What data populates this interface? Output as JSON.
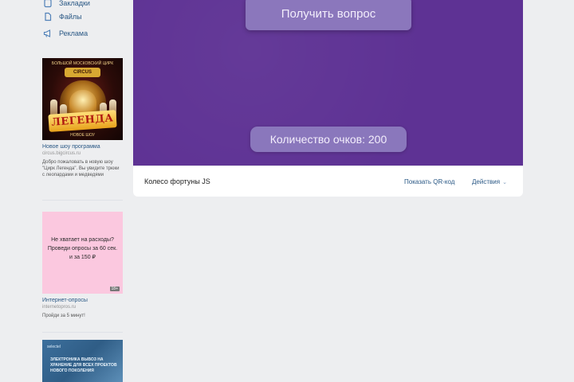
{
  "sidebar": {
    "items": [
      {
        "label": "Закладки",
        "icon": "bookmark-icon"
      },
      {
        "label": "Файлы",
        "icon": "file-icon"
      },
      {
        "label": "Реклама",
        "icon": "megaphone-icon"
      }
    ]
  },
  "ads": [
    {
      "banner_top": "БОЛЬШОЙ МОСКОВСКИЙ ЦИРК",
      "banner_logo": "CIRCUS",
      "banner_headline": "ЛЕГЕНДА",
      "banner_sub": "НОВОЕ ШОУ",
      "title": "Новое шоу программа",
      "domain": "circus.bigcircus.ru",
      "description": "Добро пожаловать в новую шоу \"Цирк Легенда\". Вы увидите трюки с леопардами и медведями"
    },
    {
      "banner_text": "Не хватает на расходы? Проведи опросы за 60 сек. и за 150 ₽",
      "banner_tag": "18+",
      "title": "Интернет-опросы",
      "domain": "internetopros.ru",
      "description": "Пройди за 5 минут!"
    },
    {
      "banner_brand": "selectel",
      "banner_headline": "ЭЛЕКТРОНИКА ВЫВОЗ НА ХРАНЕНИЕ ДЛЯ ВСЕХ ПРОЕКТОВ НОВОГО ПОКОЛЕНИЯ"
    }
  ],
  "app": {
    "get_question_label": "Получить вопрос",
    "score_label": "Количество очков: 200"
  },
  "footer": {
    "title": "Колесо фортуны JS",
    "qr_label": "Показать QR-код",
    "actions_label": "Действия"
  },
  "colors": {
    "app_background": "#5e3294",
    "button": "#8b77bc",
    "link": "#2a5885",
    "page_background": "#edeef0"
  }
}
